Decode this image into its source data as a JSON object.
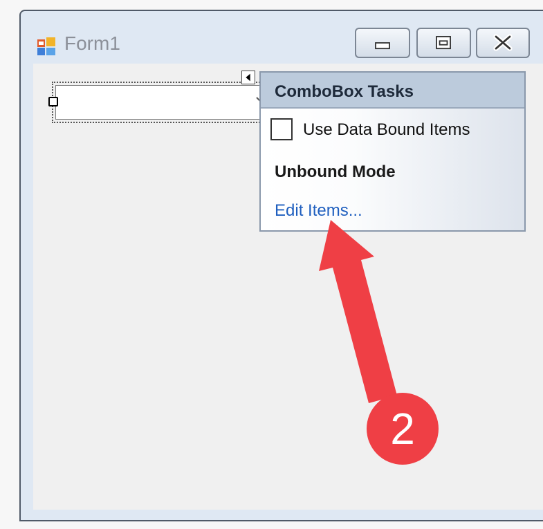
{
  "window": {
    "title": "Form1",
    "controls": {
      "minimize_icon": "minimize-icon",
      "maximize_icon": "maximize-icon",
      "close_icon": "close-icon"
    }
  },
  "combobox": {
    "value": "",
    "arrow_icon": "chevron-down-icon"
  },
  "tasks_panel": {
    "title": "ComboBox Tasks",
    "checkbox_label": "Use Data Bound Items",
    "checkbox_checked": false,
    "mode_label": "Unbound Mode",
    "link_label": "Edit Items..."
  },
  "annotation": {
    "step_number": "2",
    "color": "#ef3f45"
  },
  "colors": {
    "link": "#1f5fbf",
    "panel_header": "#bccbdc",
    "window_frame": "#dfe8f3"
  }
}
